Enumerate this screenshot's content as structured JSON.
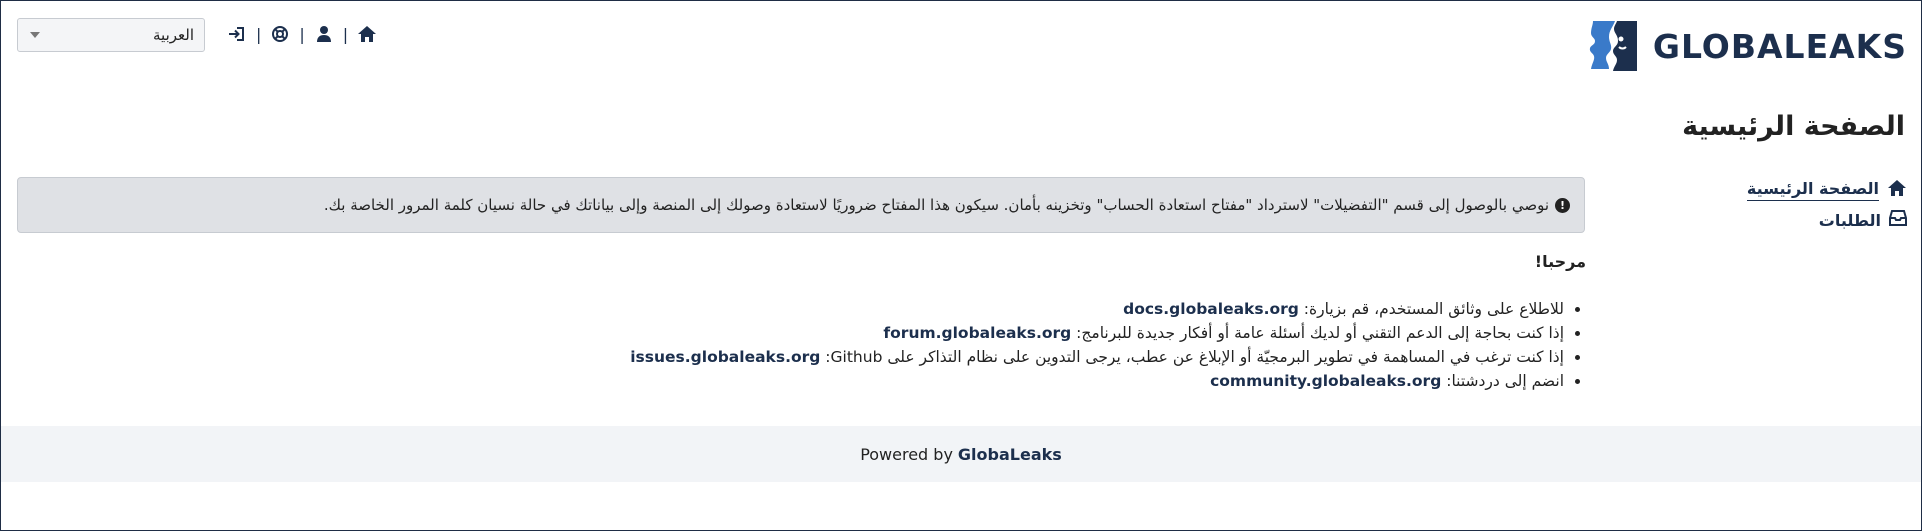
{
  "header": {
    "logo_text": "GLOBALEAKS",
    "language_select": {
      "selected": "العربية"
    },
    "toolbar_icons": [
      "home-icon",
      "user-icon",
      "support-icon",
      "sign-in-icon"
    ],
    "separator": "|"
  },
  "page": {
    "title": "الصفحة الرئيسية"
  },
  "sidebar": {
    "items": [
      {
        "label": "الصفحة الرئيسية",
        "icon": "home-icon",
        "active": true
      },
      {
        "label": "الطلبات",
        "icon": "inbox-icon",
        "active": false
      }
    ]
  },
  "alert": {
    "text": "نوصي بالوصول إلى قسم \"التفضيلات\" لاسترداد \"مفتاح استعادة الحساب\" وتخزينه بأمان. سيكون هذا المفتاح ضروريًا لاستعادة وصولك إلى المنصة وإلى بياناتك في حالة نسيان كلمة المرور الخاصة بك."
  },
  "welcome": {
    "heading": "مرحبا!",
    "items": [
      {
        "text": "للاطلاع على وثائق المستخدم، قم بزيارة: ",
        "link": "docs.globaleaks.org",
        "suffix": ""
      },
      {
        "text": "إذا كنت بحاجة إلى الدعم التقني أو لديك أسئلة عامة أو أفكار جديدة للبرنامج: ",
        "link": "forum.globaleaks.org",
        "suffix": ""
      },
      {
        "text": "إذا كنت ترغب في المساهمة في تطوير البرمجيّة أو الإبلاغ عن عطب، يرجى التدوين على نظام التذاكر على ",
        "link": "issues.globaleaks.org",
        "suffix": " :Github"
      },
      {
        "text": "انضم إلى دردشتنا: ",
        "link": "community.globaleaks.org",
        "suffix": ""
      }
    ]
  },
  "footer": {
    "powered_by": "Powered by",
    "brand": "GlobaLeaks"
  },
  "colors": {
    "brand_navy": "#1c2f4d",
    "brand_blue": "#3a7ac9",
    "alert_bg": "#dfe1e5",
    "footer_bg": "#f2f4f7"
  }
}
